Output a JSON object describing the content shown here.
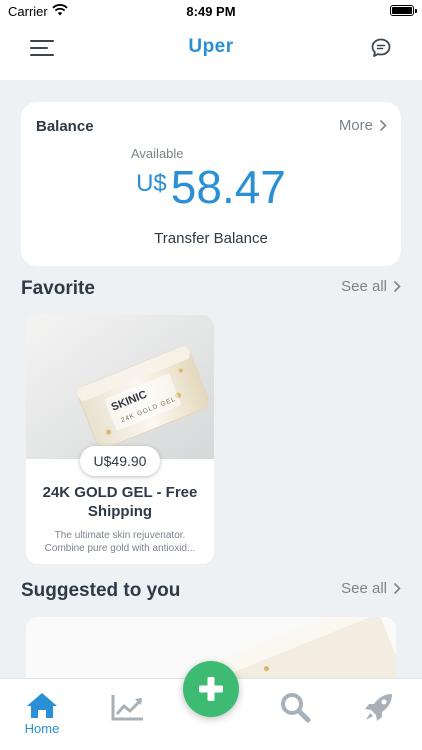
{
  "status_bar": {
    "carrier": "Carrier",
    "time": "8:49 PM"
  },
  "header": {
    "logo_text": "Uper"
  },
  "balance": {
    "title": "Balance",
    "more_label": "More",
    "available_label": "Available",
    "currency": "U$",
    "amount": "58.47",
    "transfer_label": "Transfer Balance"
  },
  "favorite": {
    "title": "Favorite",
    "see_all": "See all",
    "items": [
      {
        "price": "U$49.90",
        "name": "24K GOLD GEL - Free Shipping",
        "description_line1": "The ultimate skin rejuvenator.",
        "description_line2": "Combine pure gold with antioxid...",
        "image_brand": "SKINIC",
        "image_label": "24K GOLD GEL"
      }
    ]
  },
  "suggested": {
    "title": "Suggested to you",
    "see_all": "See all"
  },
  "tab_bar": {
    "items": [
      {
        "label": "Home",
        "icon": "home-icon",
        "active": true
      },
      {
        "label": "",
        "icon": "chart-icon",
        "active": false
      },
      {
        "label": "",
        "icon": "search-icon",
        "active": false
      },
      {
        "label": "",
        "icon": "rocket-icon",
        "active": false
      }
    ],
    "fab_icon": "plus-icon"
  },
  "colors": {
    "accent": "#2b8fd6",
    "fab": "#3dbb72",
    "background": "#eef1f3",
    "text": "#2e3a46",
    "muted": "#7c848c",
    "inactive_icon": "#a9b1b8"
  }
}
